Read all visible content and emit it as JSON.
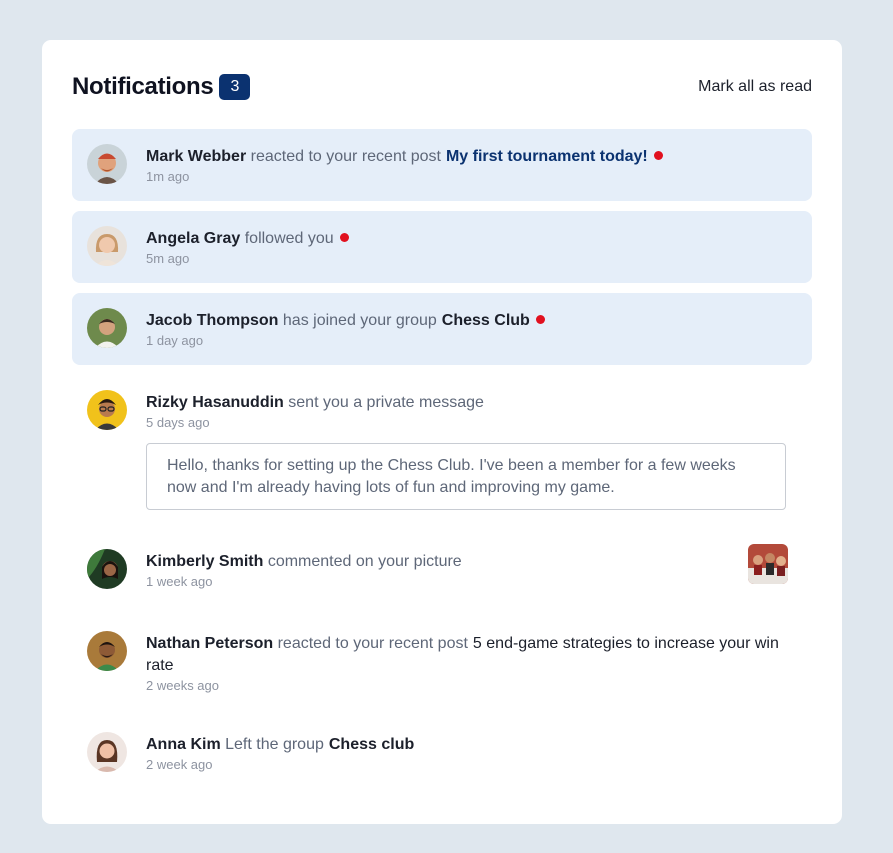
{
  "header": {
    "title": "Notifications",
    "unread_count": "3",
    "mark_all_label": "Mark all as read"
  },
  "notifications": [
    {
      "name": "Mark Webber",
      "action": "reacted to your recent post",
      "target": "My first tournament today!",
      "time": "1m ago",
      "unread": true
    },
    {
      "name": "Angela Gray",
      "action": "followed you",
      "time": "5m ago",
      "unread": true
    },
    {
      "name": "Jacob Thompson",
      "action": "has joined your group",
      "target": "Chess Club",
      "time": "1 day ago",
      "unread": true
    },
    {
      "name": "Rizky Hasanuddin",
      "action": "sent you a private message",
      "time": "5 days ago",
      "unread": false,
      "message": "Hello, thanks for setting up the Chess Club. I've been a member for a few weeks now and I'm already having lots of fun and improving my game."
    },
    {
      "name": "Kimberly Smith",
      "action": "commented on your picture",
      "time": "1 week ago",
      "unread": false
    },
    {
      "name": "Nathan Peterson",
      "action": "reacted to your recent post",
      "target": "5 end-game strategies to increase your win rate",
      "time": "2 weeks ago",
      "unread": false
    },
    {
      "name": "Anna Kim",
      "action": "Left the group",
      "target": "Chess club",
      "time": "2 week ago",
      "unread": false
    }
  ],
  "colors": {
    "page_bg": "#dfe7ee",
    "unread_bg": "#e5eef9",
    "badge_bg": "#0b3270",
    "dot": "#e1101f"
  }
}
